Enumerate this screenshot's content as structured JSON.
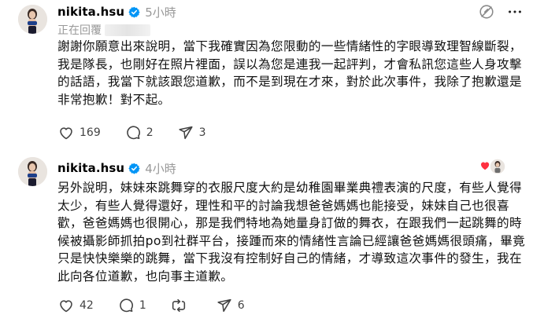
{
  "posts": [
    {
      "username": "nikita.hsu",
      "time": "5小時",
      "replying_label": "正在回覆",
      "body": "謝謝你願意出來說明，當下我確實因為您限動的一些情緒性的字眼導致理智線斷裂，我是隊長，也剛好在照片裡面，誤以為您是連我一起評判，才會私訊您這些人身攻擊的話語，我當下就該跟您道歉，而不是到現在才來，對於此次事件，我除了抱歉還是非常抱歉！對不起。",
      "actions": {
        "like_count": "169",
        "comment_count": "2",
        "share_count": "3"
      },
      "icons": [
        "avatar",
        "verified-badge-icon",
        "like-icon",
        "comment-icon",
        "share-icon",
        "quote-off-icon",
        "more-options-icon"
      ]
    },
    {
      "username": "nikita.hsu",
      "time": "4小時",
      "body": "另外說明，妹妹來跳舞穿的衣服尺度大約是幼稚園畢業典禮表演的尺度，有些人覺得太少，有些人覺得還好，理性和平的討論我想爸爸媽媽也能接受，妹妹自己也很喜歡，爸爸媽媽也很開心，那是我們特地為她量身訂做的舞衣，在跟我們一起跳舞的時候被攝影師抓拍po到社群平台，接踵而來的情緒性言論已經讓爸爸媽媽很頭痛，畢竟只是快快樂樂的跳舞，當下我沒有控制好自己的情緒，才導致這次事件的發生，我在此向各位道歉，也向事主道歉。",
      "actions": {
        "like_count": "42",
        "comment_count": "1",
        "repost_count": "",
        "share_count": "6"
      },
      "icons": [
        "avatar",
        "verified-badge-icon",
        "replied-by-badge",
        "like-icon",
        "comment-icon",
        "repost-icon",
        "share-icon"
      ]
    }
  ],
  "colors": {
    "verified": "#0095f6",
    "secondary_text": "#999999",
    "count_text": "#424242",
    "heart_accent": "#ff3040"
  }
}
